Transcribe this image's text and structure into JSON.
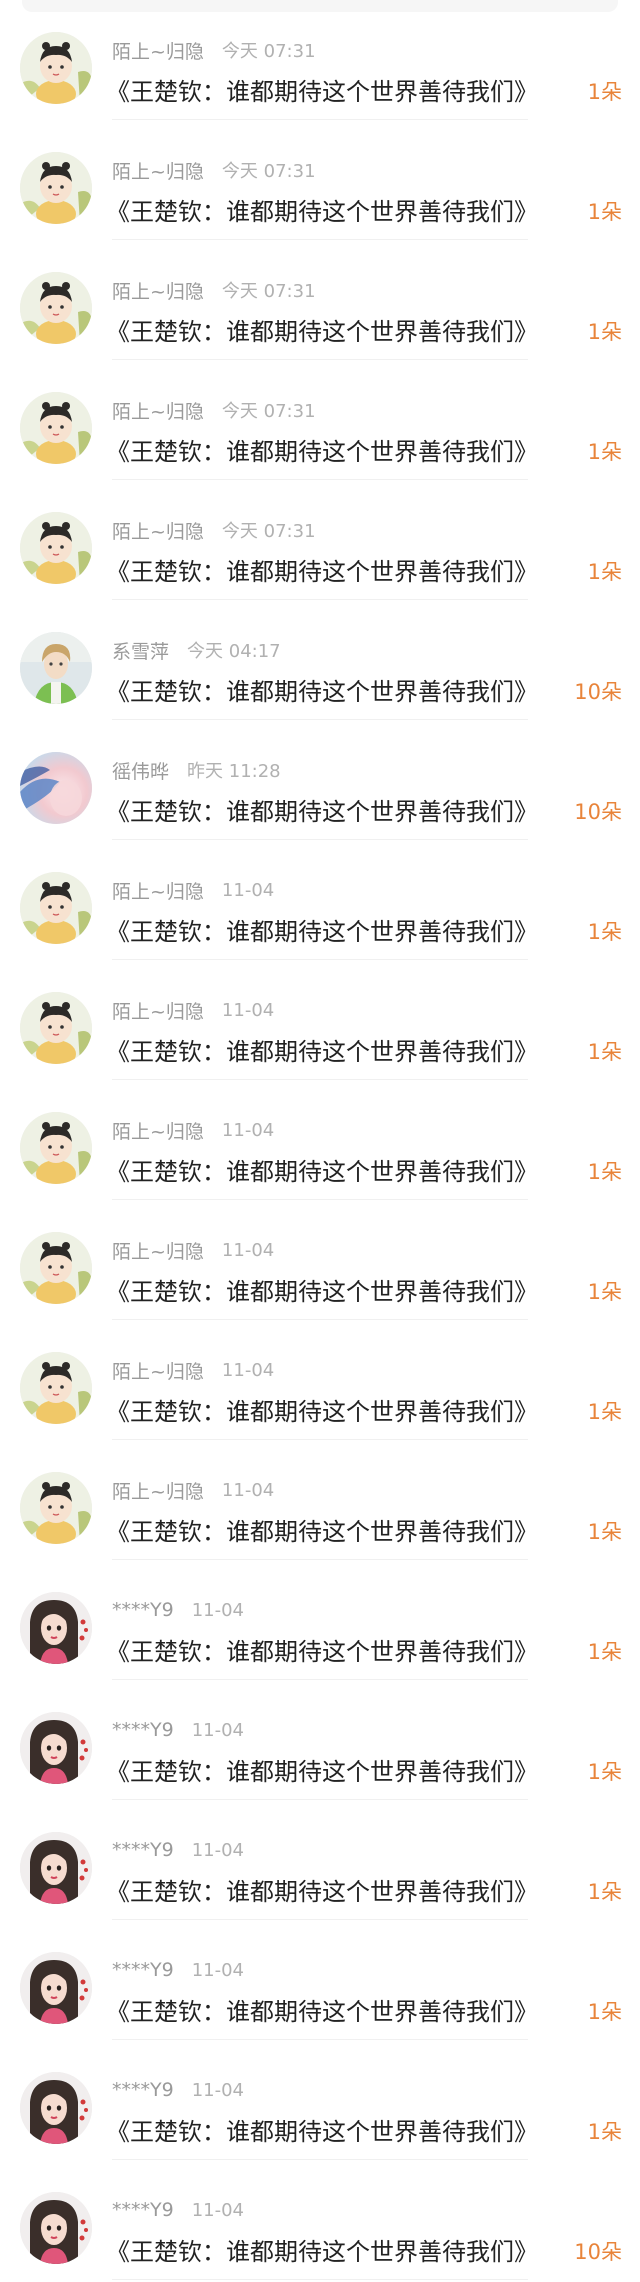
{
  "colors": {
    "username": "#9a9a9a",
    "time": "#b1b1b1",
    "message": "#222222",
    "gift_count": "#e8843a",
    "divider": "#f0f0f0"
  },
  "rows": [
    {
      "user": "陌上~归隐",
      "time": "今天 07:31",
      "message": "《王楚钦：谁都期待这个世界善待我们》",
      "gift": "1朵",
      "avatar": "cartoon-boy-avatar"
    },
    {
      "user": "陌上~归隐",
      "time": "今天 07:31",
      "message": "《王楚钦：谁都期待这个世界善待我们》",
      "gift": "1朵",
      "avatar": "cartoon-boy-avatar"
    },
    {
      "user": "陌上~归隐",
      "time": "今天 07:31",
      "message": "《王楚钦：谁都期待这个世界善待我们》",
      "gift": "1朵",
      "avatar": "cartoon-boy-avatar"
    },
    {
      "user": "陌上~归隐",
      "time": "今天 07:31",
      "message": "《王楚钦：谁都期待这个世界善待我们》",
      "gift": "1朵",
      "avatar": "cartoon-boy-avatar"
    },
    {
      "user": "陌上~归隐",
      "time": "今天 07:31",
      "message": "《王楚钦：谁都期待这个世界善待我们》",
      "gift": "1朵",
      "avatar": "cartoon-boy-avatar"
    },
    {
      "user": "系雪萍",
      "time": "今天 04:17",
      "message": "《王楚钦：谁都期待这个世界善待我们》",
      "gift": "10朵",
      "avatar": "anime-man-avatar"
    },
    {
      "user": "徭伟晔",
      "time": "昨天 11:28",
      "message": "《王楚钦：谁都期待这个世界善待我们》",
      "gift": "10朵",
      "avatar": "blurred-photo-avatar"
    },
    {
      "user": "陌上~归隐",
      "time": "11-04",
      "message": "《王楚钦：谁都期待这个世界善待我们》",
      "gift": "1朵",
      "avatar": "cartoon-boy-avatar"
    },
    {
      "user": "陌上~归隐",
      "time": "11-04",
      "message": "《王楚钦：谁都期待这个世界善待我们》",
      "gift": "1朵",
      "avatar": "cartoon-boy-avatar"
    },
    {
      "user": "陌上~归隐",
      "time": "11-04",
      "message": "《王楚钦：谁都期待这个世界善待我们》",
      "gift": "1朵",
      "avatar": "cartoon-boy-avatar"
    },
    {
      "user": "陌上~归隐",
      "time": "11-04",
      "message": "《王楚钦：谁都期待这个世界善待我们》",
      "gift": "1朵",
      "avatar": "cartoon-boy-avatar"
    },
    {
      "user": "陌上~归隐",
      "time": "11-04",
      "message": "《王楚钦：谁都期待这个世界善待我们》",
      "gift": "1朵",
      "avatar": "cartoon-boy-avatar"
    },
    {
      "user": "陌上~归隐",
      "time": "11-04",
      "message": "《王楚钦：谁都期待这个世界善待我们》",
      "gift": "1朵",
      "avatar": "cartoon-boy-avatar"
    },
    {
      "user": "****Y9",
      "time": "11-04",
      "message": "《王楚钦：谁都期待这个世界善待我们》",
      "gift": "1朵",
      "avatar": "cartoon-girl-avatar"
    },
    {
      "user": "****Y9",
      "time": "11-04",
      "message": "《王楚钦：谁都期待这个世界善待我们》",
      "gift": "1朵",
      "avatar": "cartoon-girl-avatar"
    },
    {
      "user": "****Y9",
      "time": "11-04",
      "message": "《王楚钦：谁都期待这个世界善待我们》",
      "gift": "1朵",
      "avatar": "cartoon-girl-avatar"
    },
    {
      "user": "****Y9",
      "time": "11-04",
      "message": "《王楚钦：谁都期待这个世界善待我们》",
      "gift": "1朵",
      "avatar": "cartoon-girl-avatar"
    },
    {
      "user": "****Y9",
      "time": "11-04",
      "message": "《王楚钦：谁都期待这个世界善待我们》",
      "gift": "1朵",
      "avatar": "cartoon-girl-avatar"
    },
    {
      "user": "****Y9",
      "time": "11-04",
      "message": "《王楚钦：谁都期待这个世界善待我们》",
      "gift": "10朵",
      "avatar": "cartoon-girl-avatar"
    }
  ]
}
